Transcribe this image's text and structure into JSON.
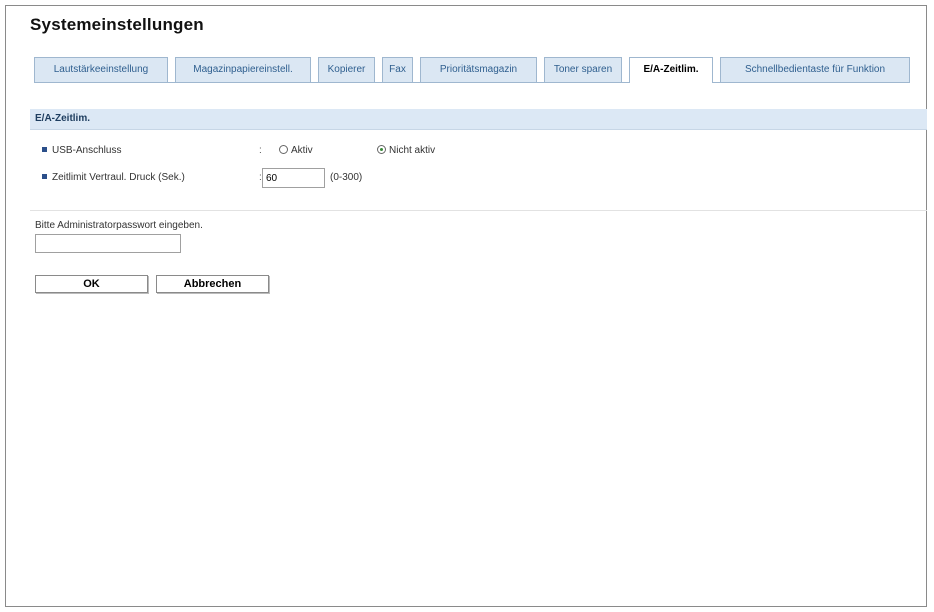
{
  "page": {
    "title": "Systemeinstellungen"
  },
  "tabs": [
    {
      "label": "Lautstärkeeinstellung",
      "active": false
    },
    {
      "label": "Magazinpapiereinstell.",
      "active": false
    },
    {
      "label": "Kopierer",
      "active": false
    },
    {
      "label": "Fax",
      "active": false
    },
    {
      "label": "Prioritätsmagazin",
      "active": false
    },
    {
      "label": "Toner sparen",
      "active": false
    },
    {
      "label": "E/A-Zeitlim.",
      "active": true
    },
    {
      "label": "Schnellbedientaste für Funktion",
      "active": false
    }
  ],
  "section": {
    "title": "E/A-Zeitlim."
  },
  "settings": {
    "usb": {
      "label": "USB-Anschluss",
      "separator": ":",
      "options": [
        {
          "label": "Aktiv",
          "selected": false
        },
        {
          "label": "Nicht aktiv",
          "selected": true
        }
      ]
    },
    "timeout": {
      "label": "Zeitlimit Vertraul. Druck (Sek.)",
      "separator": ":",
      "value": "60",
      "range": "(0-300)"
    }
  },
  "auth": {
    "prompt": "Bitte Administratorpasswort eingeben.",
    "password_value": ""
  },
  "buttons": {
    "ok": "OK",
    "cancel": "Abbrechen"
  },
  "colors": {
    "tab_bg": "#dbe7f3",
    "tab_text": "#2f5f8f",
    "section_bg": "#dce8f5",
    "bullet": "#2b4f8a"
  }
}
